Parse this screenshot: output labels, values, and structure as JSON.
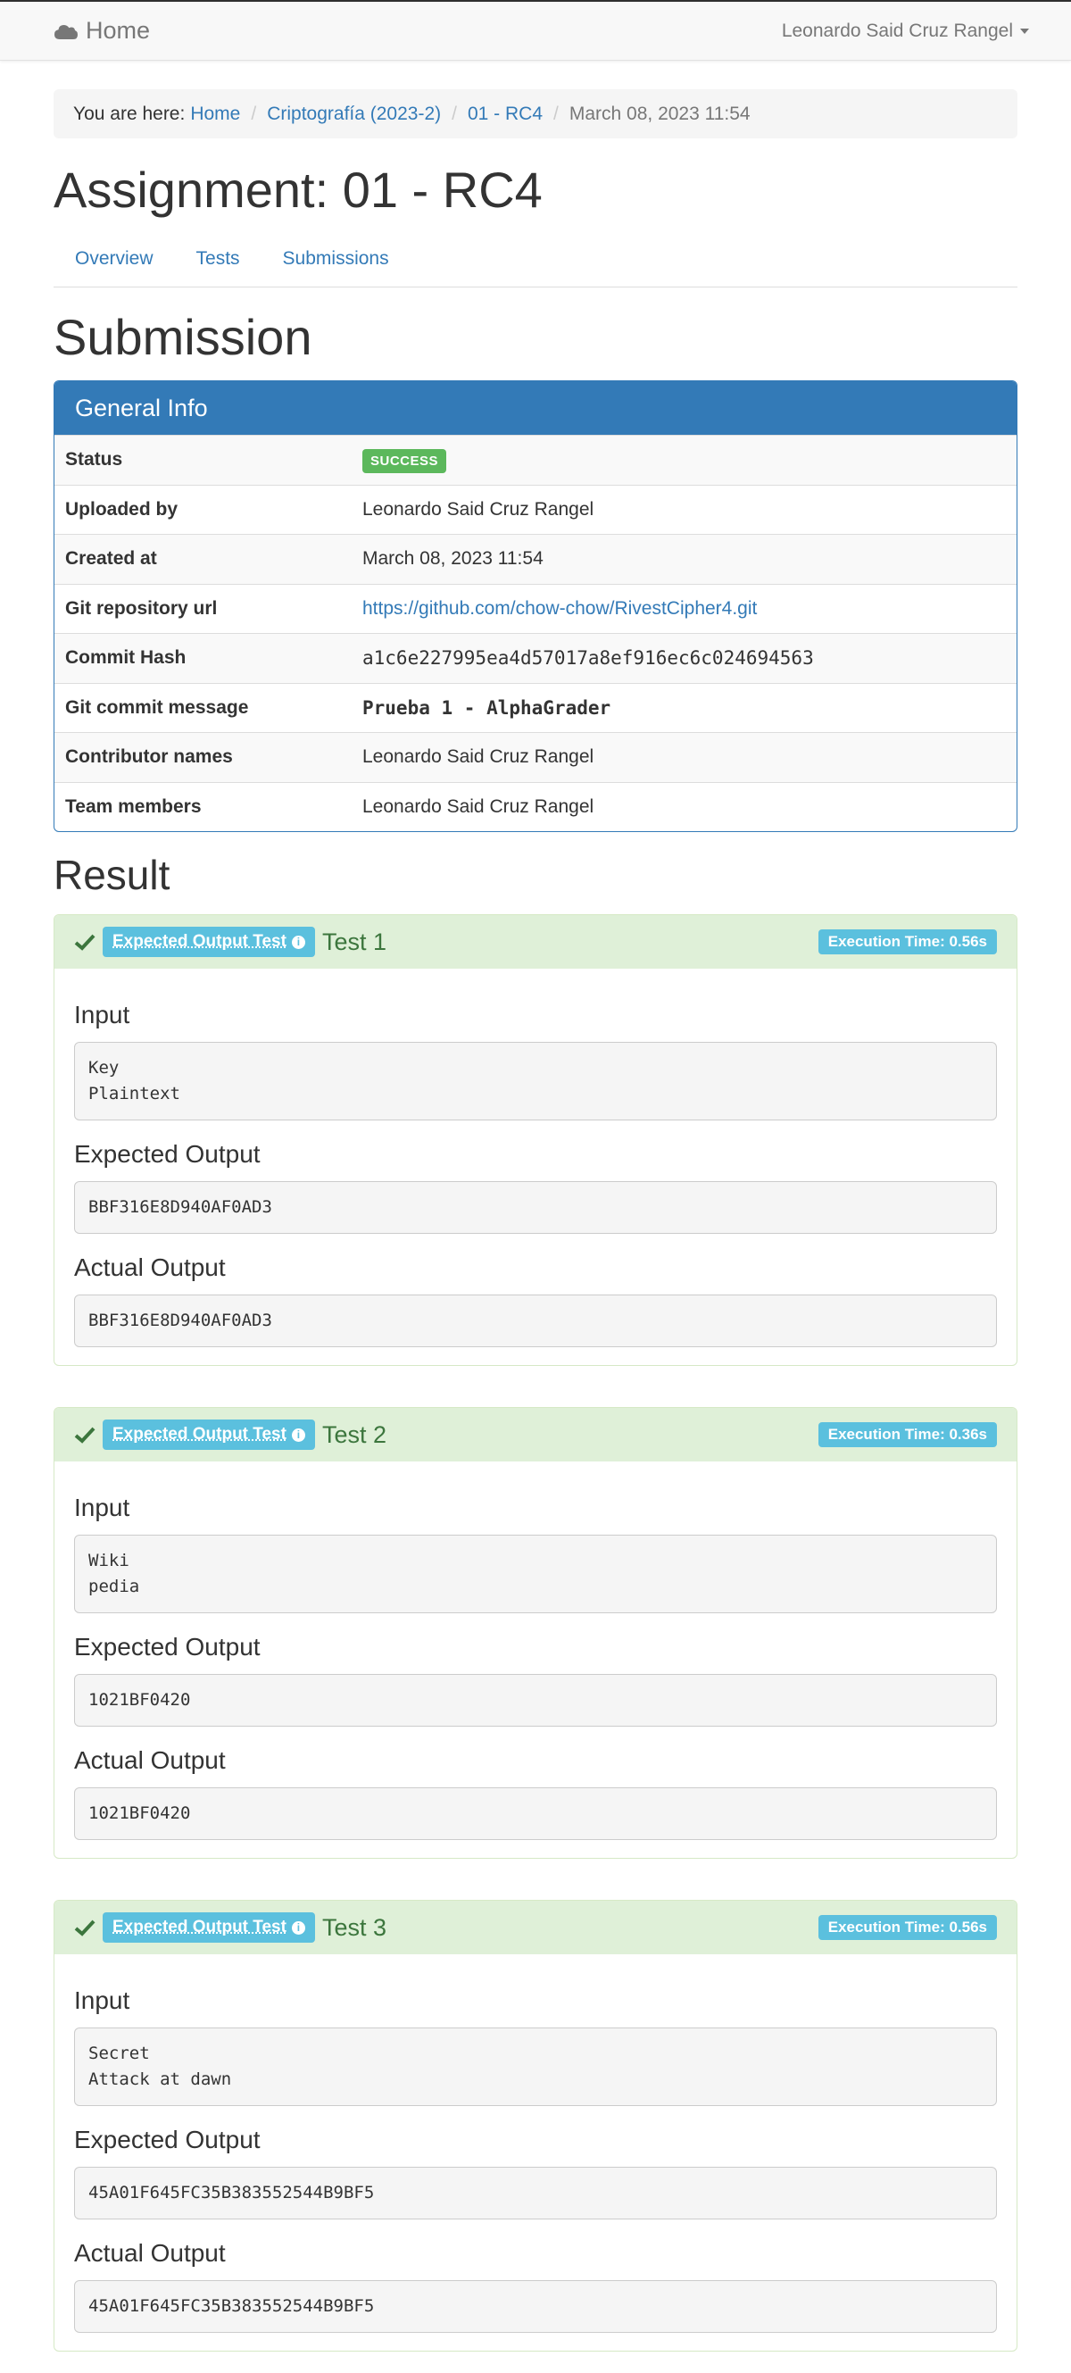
{
  "navbar": {
    "brand": "Home",
    "user": "Leonardo Said Cruz Rangel"
  },
  "breadcrumb": {
    "prefix": "You are here:",
    "items": [
      "Home",
      "Criptografía (2023-2)",
      "01 - RC4"
    ],
    "active": "March 08, 2023 11:54"
  },
  "page_title": "Assignment: 01 - RC4",
  "tabs": [
    "Overview",
    "Tests",
    "Submissions"
  ],
  "submission_title": "Submission",
  "general_info": {
    "heading": "General Info",
    "rows": [
      {
        "label": "Status",
        "value": "SUCCESS"
      },
      {
        "label": "Uploaded by",
        "value": "Leonardo Said Cruz Rangel"
      },
      {
        "label": "Created at",
        "value": "March 08, 2023 11:54"
      },
      {
        "label": "Git repository url",
        "value": "https://github.com/chow-chow/RivestCipher4.git"
      },
      {
        "label": "Commit Hash",
        "value": "a1c6e227995ea4d57017a8ef916ec6c024694563"
      },
      {
        "label": "Git commit message",
        "value": "Prueba 1 - AlphaGrader"
      },
      {
        "label": "Contributor names",
        "value": "Leonardo Said Cruz Rangel"
      },
      {
        "label": "Team members",
        "value": "Leonardo Said Cruz Rangel"
      }
    ]
  },
  "result_title": "Result",
  "field_labels": {
    "input": "Input",
    "expected": "Expected Output",
    "actual": "Actual Output"
  },
  "tests": [
    {
      "type": "Expected Output Test",
      "name": "Test 1",
      "execution_time": "Execution Time: 0.56s",
      "input": "Key\nPlaintext",
      "expected_output": "BBF316E8D940AF0AD3",
      "actual_output": "BBF316E8D940AF0AD3"
    },
    {
      "type": "Expected Output Test",
      "name": "Test 2",
      "execution_time": "Execution Time: 0.36s",
      "input": "Wiki\npedia",
      "expected_output": "1021BF0420",
      "actual_output": "1021BF0420"
    },
    {
      "type": "Expected Output Test",
      "name": "Test 3",
      "execution_time": "Execution Time: 0.56s",
      "input": "Secret\nAttack at dawn",
      "expected_output": "45A01F645FC35B383552544B9BF5",
      "actual_output": "45A01F645FC35B383552544B9BF5"
    }
  ],
  "colors": {
    "primary": "#337ab7",
    "success": "#5cb85c",
    "info": "#5bc0de",
    "success_bg": "#dff0d8",
    "success_text": "#3c763d"
  }
}
